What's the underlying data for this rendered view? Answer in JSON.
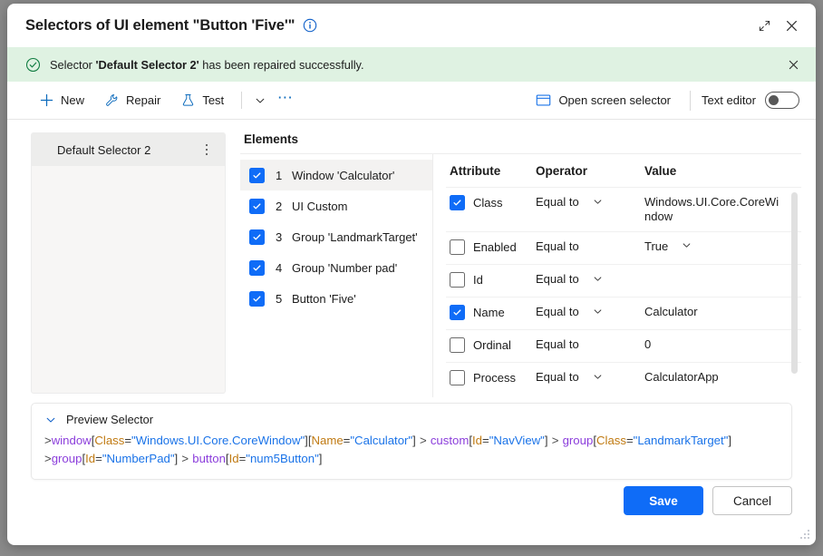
{
  "window": {
    "title": "Selectors of UI element \"Button 'Five'\"",
    "info_icon": "info-circle-icon",
    "expand_icon": "expand-diagonal-icon",
    "close_icon": "close-icon"
  },
  "banner": {
    "icon": "check-circle-icon",
    "prefix": "Selector ",
    "bold": "'Default Selector 2'",
    "suffix": " has been repaired successfully.",
    "close_icon": "close-icon",
    "background": "#dff2e2",
    "icon_color": "#107c41"
  },
  "toolbar": {
    "new_label": "New",
    "new_icon": "plus-icon",
    "repair_label": "Repair",
    "repair_icon": "wrench-icon",
    "test_label": "Test",
    "test_icon": "flask-icon",
    "overflow_chevron_icon": "chevron-down-icon",
    "more_icon": "ellipsis-icon",
    "open_screen_selector_label": "Open screen selector",
    "open_screen_selector_icon": "window-rect-icon",
    "text_editor_label": "Text editor",
    "text_editor_on": false,
    "accent_color": "#0f6cbd"
  },
  "selectors": {
    "items": [
      {
        "name": "Default Selector 2",
        "selected": true,
        "menu_icon": "kebab-menu-icon"
      }
    ]
  },
  "elements": {
    "title": "Elements",
    "items": [
      {
        "index": "1",
        "label": "Window 'Calculator'",
        "checked": true,
        "selected": true
      },
      {
        "index": "2",
        "label": "UI Custom",
        "checked": true,
        "selected": false
      },
      {
        "index": "3",
        "label": "Group 'LandmarkTarget'",
        "checked": true,
        "selected": false
      },
      {
        "index": "4",
        "label": "Group 'Number pad'",
        "checked": true,
        "selected": false
      },
      {
        "index": "5",
        "label": "Button 'Five'",
        "checked": true,
        "selected": false
      }
    ]
  },
  "attributes": {
    "headers": {
      "attribute": "Attribute",
      "operator": "Operator",
      "value": "Value"
    },
    "rows": [
      {
        "name": "Class",
        "checked": true,
        "operator": "Equal to",
        "operator_chevron": true,
        "value": "Windows.UI.Core.CoreWindow",
        "value_chevron": false
      },
      {
        "name": "Enabled",
        "checked": false,
        "operator": "Equal to",
        "operator_chevron": false,
        "value": "True",
        "value_chevron": true
      },
      {
        "name": "Id",
        "checked": false,
        "operator": "Equal to",
        "operator_chevron": true,
        "value": "",
        "value_chevron": false
      },
      {
        "name": "Name",
        "checked": true,
        "operator": "Equal to",
        "operator_chevron": true,
        "value": "Calculator",
        "value_chevron": false
      },
      {
        "name": "Ordinal",
        "checked": false,
        "operator": "Equal to",
        "operator_chevron": false,
        "value": "0",
        "value_chevron": false
      },
      {
        "name": "Process",
        "checked": false,
        "operator": "Equal to",
        "operator_chevron": true,
        "value": "CalculatorApp",
        "value_chevron": false
      }
    ]
  },
  "preview": {
    "label": "Preview Selector",
    "chevron_icon": "chevron-down-icon",
    "lines": [
      [
        {
          "t": "gt",
          "s": ">"
        },
        {
          "t": "tag",
          "s": "window"
        },
        {
          "t": "br",
          "s": "["
        },
        {
          "t": "attr",
          "s": "Class"
        },
        {
          "t": "br",
          "s": "="
        },
        {
          "t": "str",
          "s": "\"Windows.UI.Core.CoreWindow\""
        },
        {
          "t": "br",
          "s": "]["
        },
        {
          "t": "attr",
          "s": "Name"
        },
        {
          "t": "br",
          "s": "="
        },
        {
          "t": "str",
          "s": "\"Calculator\""
        },
        {
          "t": "br",
          "s": "]"
        },
        {
          "t": "gt",
          "s": " > "
        },
        {
          "t": "tag",
          "s": "custom"
        },
        {
          "t": "br",
          "s": "["
        },
        {
          "t": "attr",
          "s": "Id"
        },
        {
          "t": "br",
          "s": "="
        },
        {
          "t": "str",
          "s": "\"NavView\""
        },
        {
          "t": "br",
          "s": "]"
        },
        {
          "t": "gt",
          "s": " > "
        },
        {
          "t": "tag",
          "s": "group"
        },
        {
          "t": "br",
          "s": "["
        },
        {
          "t": "attr",
          "s": "Class"
        },
        {
          "t": "br",
          "s": "="
        },
        {
          "t": "str",
          "s": "\"LandmarkTarget\""
        },
        {
          "t": "br",
          "s": "]"
        }
      ],
      [
        {
          "t": "gt",
          "s": ">"
        },
        {
          "t": "tag",
          "s": "group"
        },
        {
          "t": "br",
          "s": "["
        },
        {
          "t": "attr",
          "s": "Id"
        },
        {
          "t": "br",
          "s": "="
        },
        {
          "t": "str",
          "s": "\"NumberPad\""
        },
        {
          "t": "br",
          "s": "]"
        },
        {
          "t": "gt",
          "s": " > "
        },
        {
          "t": "tag",
          "s": "button"
        },
        {
          "t": "br",
          "s": "["
        },
        {
          "t": "attr",
          "s": "Id"
        },
        {
          "t": "br",
          "s": "="
        },
        {
          "t": "str",
          "s": "\"num5Button\""
        },
        {
          "t": "br",
          "s": "]"
        }
      ]
    ]
  },
  "footer": {
    "save_label": "Save",
    "cancel_label": "Cancel",
    "primary_color": "#0f6cf7"
  }
}
